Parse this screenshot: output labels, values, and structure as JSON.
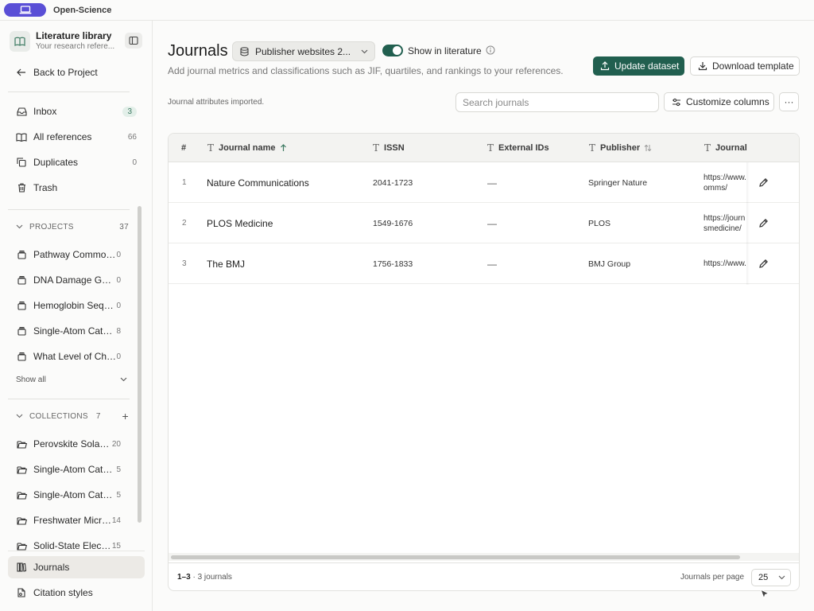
{
  "app": {
    "name": "Open-Science"
  },
  "sidebar": {
    "library_title": "Literature library",
    "library_subtitle": "Your research refere...",
    "back_label": "Back to Project",
    "nav": [
      {
        "label": "Inbox",
        "count": "3",
        "icon": "inbox-icon"
      },
      {
        "label": "All references",
        "count": "66",
        "icon": "book-open-icon"
      },
      {
        "label": "Duplicates",
        "count": "0",
        "icon": "copy-icon"
      },
      {
        "label": "Trash",
        "count": "",
        "icon": "trash-icon"
      }
    ],
    "projects_header": "PROJECTS",
    "projects_count": "37",
    "projects": [
      {
        "label": "Pathway Commons...",
        "count": "0"
      },
      {
        "label": "DNA Damage Gene...",
        "count": "0"
      },
      {
        "label": "Hemoglobin Seque...",
        "count": "0"
      },
      {
        "label": "Single-Atom Cataly...",
        "count": "8"
      },
      {
        "label": "What Level of Ches...",
        "count": "0"
      }
    ],
    "show_all": "Show all",
    "collections_header": "COLLECTIONS",
    "collections_count": "7",
    "collections": [
      {
        "label": "Perovskite Solar-...",
        "count": "20"
      },
      {
        "label": "Single-Atom Cataly...",
        "count": "5"
      },
      {
        "label": "Single-Atom Cataly...",
        "count": "5"
      },
      {
        "label": "Freshwater Micro...",
        "count": "14"
      },
      {
        "label": "Solid-State Electr...",
        "count": "15"
      }
    ],
    "bottom": [
      {
        "label": "Journals",
        "icon": "books-icon",
        "active": true
      },
      {
        "label": "Citation styles",
        "icon": "citation-icon",
        "active": false
      }
    ]
  },
  "main": {
    "title": "Journals",
    "dataset_select": "Publisher websites 2...",
    "toggle_label": "Show in literature",
    "toggle_on": true,
    "subtitle": "Add journal metrics and classifications such as JIF, quartiles, and rankings to your references.",
    "update_button": "Update dataset",
    "download_button": "Download template",
    "status": "Journal attributes imported.",
    "search_placeholder": "Search journals",
    "customize_button": "Customize columns",
    "more_button": "···",
    "accent_color": "#215f4f"
  },
  "table": {
    "headers": {
      "index": "#",
      "name": "Journal name",
      "issn": "ISSN",
      "external": "External IDs",
      "publisher": "Publisher",
      "journal_url": "Journal"
    },
    "rows": [
      {
        "index": "1",
        "name": "Nature Communications",
        "issn": "2041-1723",
        "external": "—",
        "publisher": "Springer Nature",
        "url_line1": "https://www.",
        "url_line2": "omms/"
      },
      {
        "index": "2",
        "name": "PLOS Medicine",
        "issn": "1549-1676",
        "external": "—",
        "publisher": "PLOS",
        "url_line1": "https://journ",
        "url_line2": "smedicine/"
      },
      {
        "index": "3",
        "name": "The BMJ",
        "issn": "1756-1833",
        "external": "—",
        "publisher": "BMJ Group",
        "url_line1": "https://www.",
        "url_line2": ""
      }
    ],
    "footer": {
      "range": "1–3",
      "summary": " · 3 journals",
      "per_page_label": "Journals per page",
      "per_page_value": "25"
    }
  }
}
